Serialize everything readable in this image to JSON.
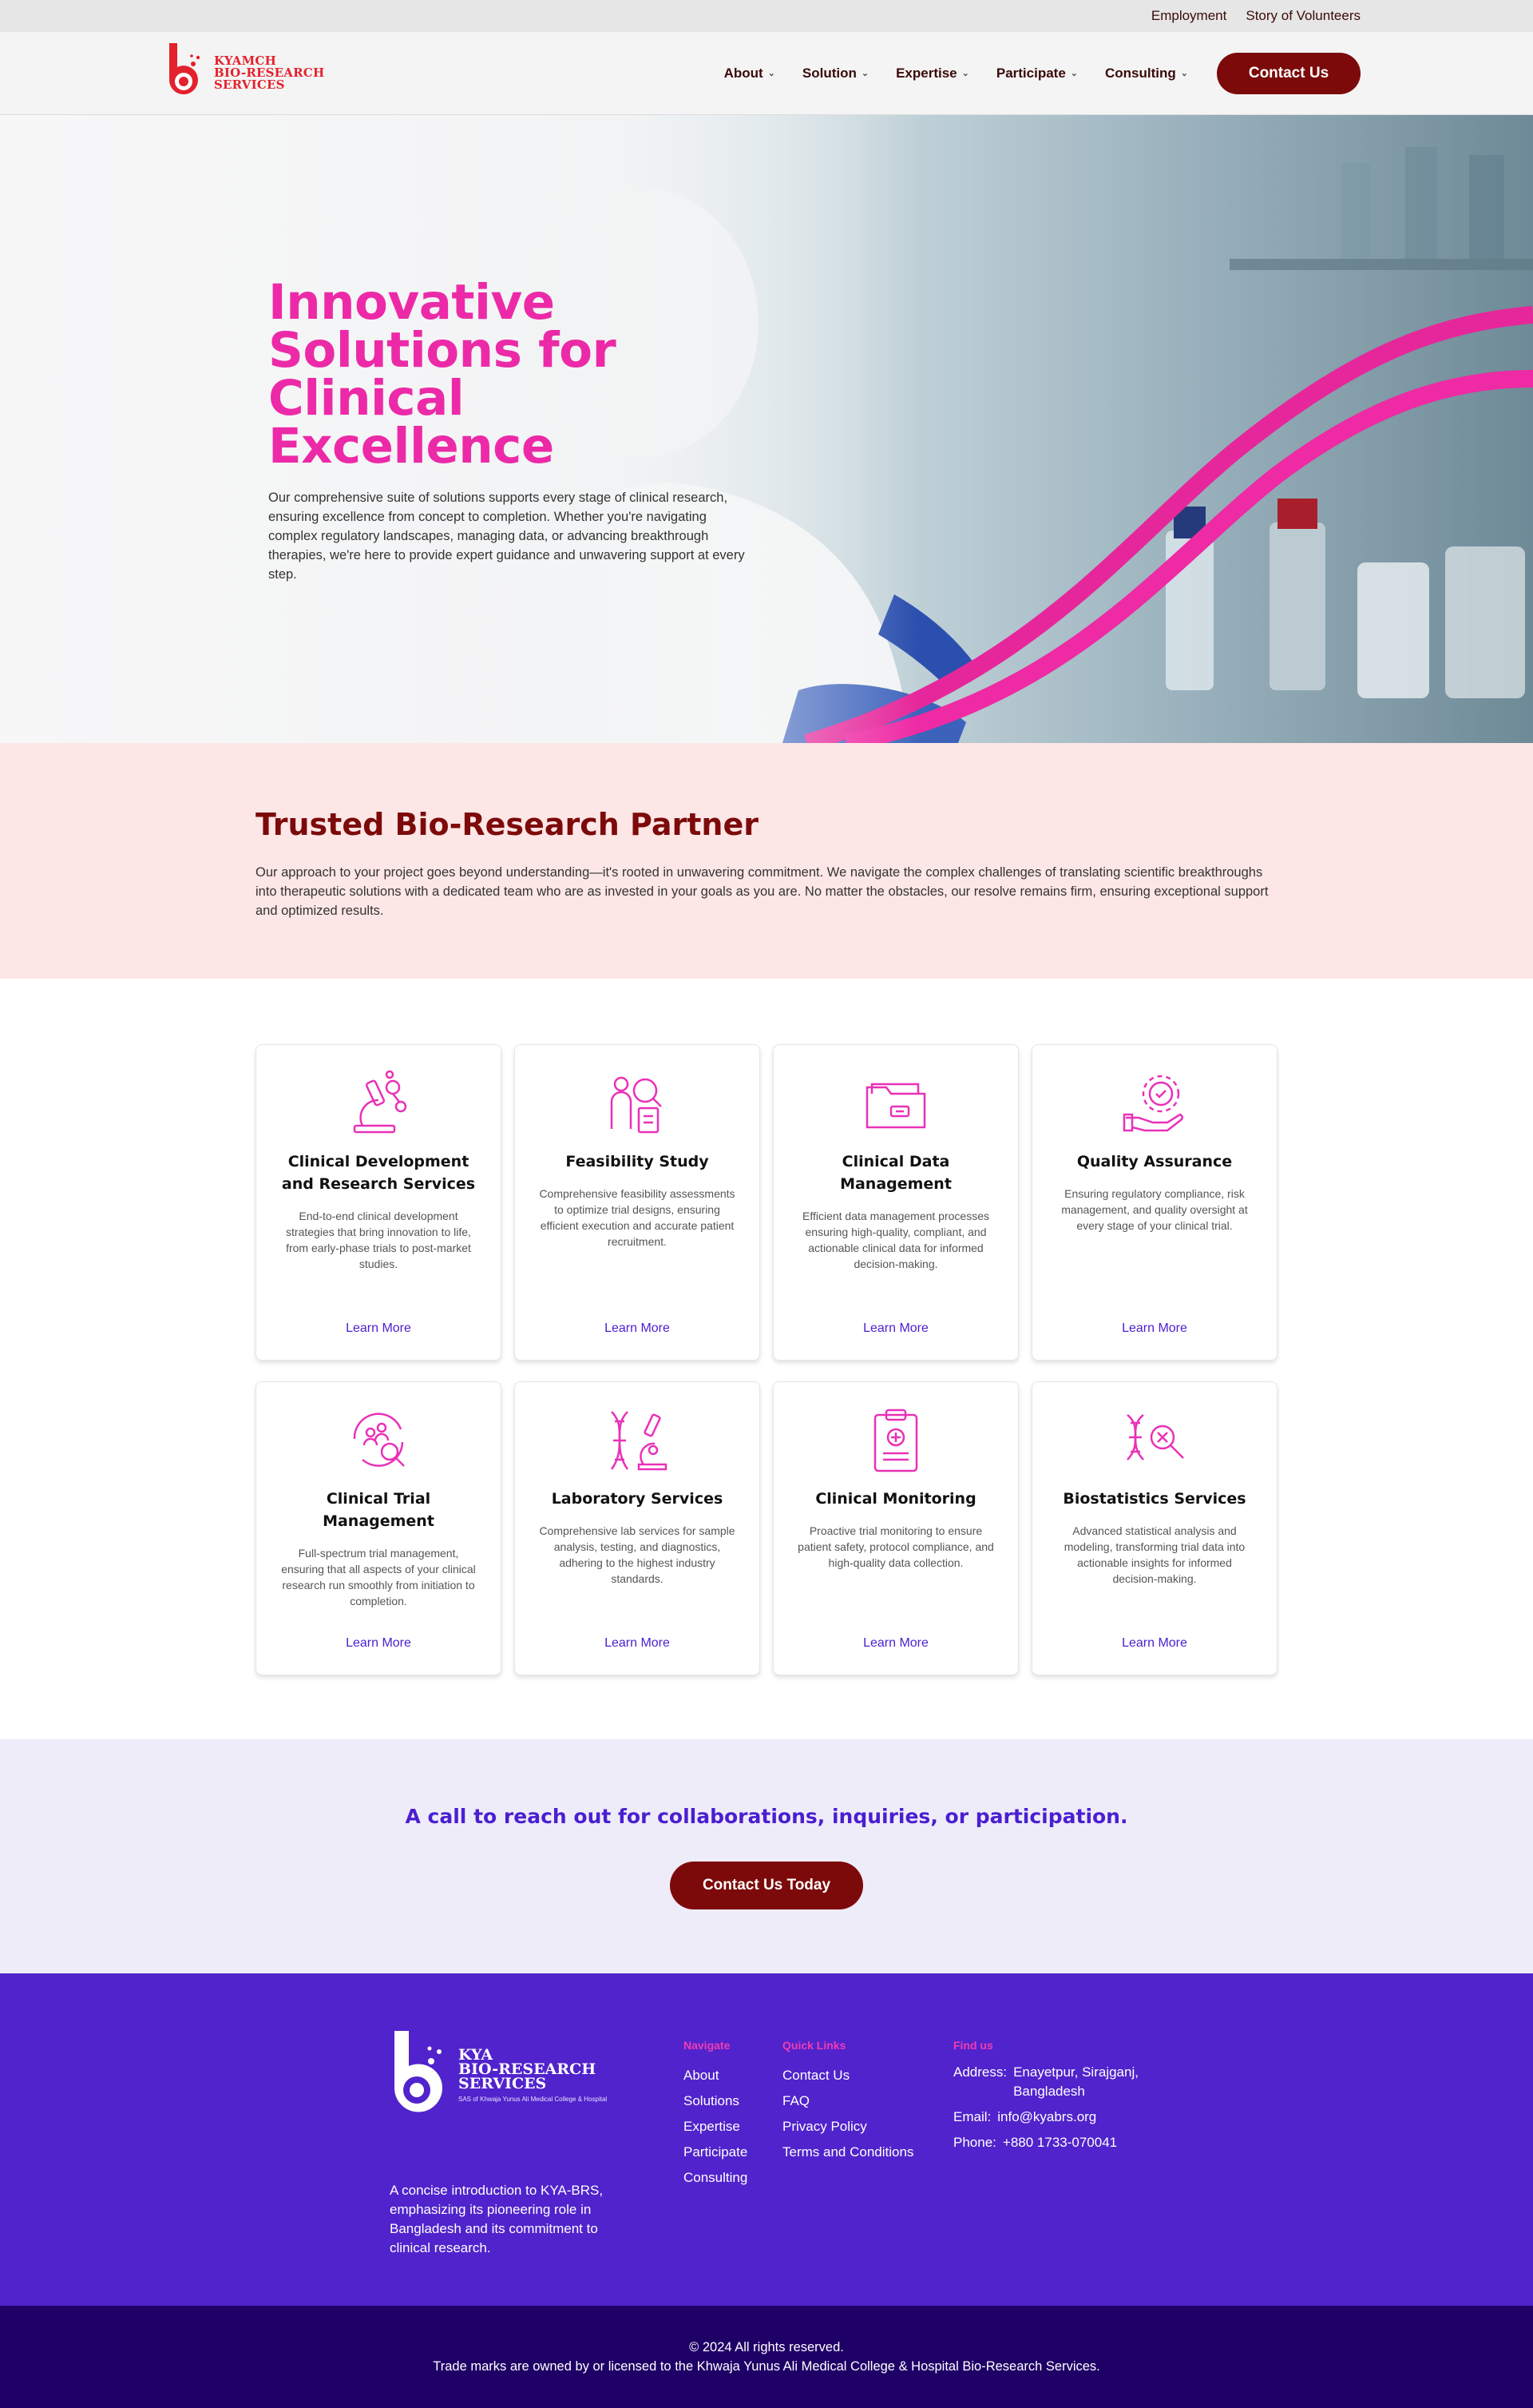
{
  "topbar": {
    "links": [
      "Employment",
      "Story of Volunteers"
    ]
  },
  "header": {
    "logo_lines": [
      "KYAMCH",
      "BIO-RESEARCH",
      "SERVICES"
    ],
    "nav": [
      "About",
      "Solution",
      "Expertise",
      "Participate",
      "Consulting"
    ],
    "contact_label": "Contact Us"
  },
  "hero": {
    "title_lines": [
      "Innovative",
      "Solutions for",
      "Clinical Excellence"
    ],
    "description": "Our comprehensive suite of solutions supports every stage of clinical research, ensuring excellence from concept to completion. Whether you're navigating complex regulatory landscapes, managing data, or advancing breakthrough therapies, we're here to provide expert guidance and unwavering support at every step."
  },
  "trusted": {
    "title": "Trusted Bio-Research Partner",
    "text": "Our approach to your project goes beyond understanding—it's rooted in unwavering commitment. We navigate the complex challenges of translating scientific breakthroughs into therapeutic solutions with a dedicated team who are as invested in your goals as you are. No matter the obstacles, our resolve remains firm, ensuring exceptional support and optimized results."
  },
  "services": [
    {
      "title": "Clinical Development and Research Services",
      "text": "End-to-end clinical development strategies that bring innovation to life, from early-phase trials to post-market studies.",
      "link": "Learn More",
      "icon": "microscope-icon"
    },
    {
      "title": "Feasibility Study",
      "text": "Comprehensive feasibility assessments to optimize trial designs, ensuring efficient execution and accurate patient recruitment.",
      "link": "Learn More",
      "icon": "researcher-search-icon"
    },
    {
      "title": "Clinical Data Management",
      "text": "Efficient data management processes ensuring high-quality, compliant, and actionable clinical data for informed decision-making.",
      "link": "Learn More",
      "icon": "folder-icon"
    },
    {
      "title": "Quality Assurance",
      "text": "Ensuring regulatory compliance, risk management, and quality oversight at every stage of your clinical trial.",
      "link": "Learn More",
      "icon": "gear-hand-icon"
    },
    {
      "title": "Clinical Trial Management",
      "text": "Full-spectrum trial management, ensuring that all aspects of your clinical research run smoothly from initiation to completion.",
      "link": "Learn More",
      "icon": "team-search-icon"
    },
    {
      "title": "Laboratory Services",
      "text": "Comprehensive lab services for sample analysis, testing, and diagnostics, adhering to the highest industry standards.",
      "link": "Learn More",
      "icon": "dna-microscope-icon"
    },
    {
      "title": "Clinical Monitoring",
      "text": "Proactive trial monitoring to ensure patient safety, protocol compliance, and high-quality data collection.",
      "link": "Learn More",
      "icon": "clipboard-icon"
    },
    {
      "title": "Biostatistics Services",
      "text": "Advanced statistical analysis and modeling, transforming trial data into actionable insights for informed decision-making.",
      "link": "Learn More",
      "icon": "dna-search-icon"
    }
  ],
  "cta": {
    "title": "A call to reach out for collaborations, inquiries, or participation.",
    "button": "Contact Us Today"
  },
  "footer": {
    "logo_lines": [
      "KYA",
      "BIO-RESEARCH",
      "SERVICES"
    ],
    "logo_sub": "SAS of Khwaja Yunus Ali Medical College & Hospital",
    "about": "A concise introduction to KYA-BRS, emphasizing its pioneering role in Bangladesh and its commitment to clinical research.",
    "navigate": {
      "title": "Navigate",
      "items": [
        "About",
        "Solutions",
        "Expertise",
        "Participate",
        "Consulting"
      ]
    },
    "quick": {
      "title": "Quick Links",
      "items": [
        "Contact Us",
        "FAQ",
        "Privacy Policy",
        "Terms and Conditions"
      ]
    },
    "find": {
      "title": "Find us",
      "address_label": "Address:",
      "address": "Enayetpur, Sirajganj, Bangladesh",
      "email_label": "Email:",
      "email": "info@kyabrs.org",
      "phone_label": "Phone:",
      "phone": "+880 1733-070041"
    },
    "copyright": "© 2024 All rights reserved.",
    "trademark": "Trade marks are owned by or licensed to the Khwaja Yunus Ali Medical College & Hospital Bio-Research Services."
  },
  "colors": {
    "brand_red": "#7d0a0a",
    "accent_pink": "#ec2aa8",
    "purple": "#5123cc",
    "deep_purple": "#1e0066"
  }
}
